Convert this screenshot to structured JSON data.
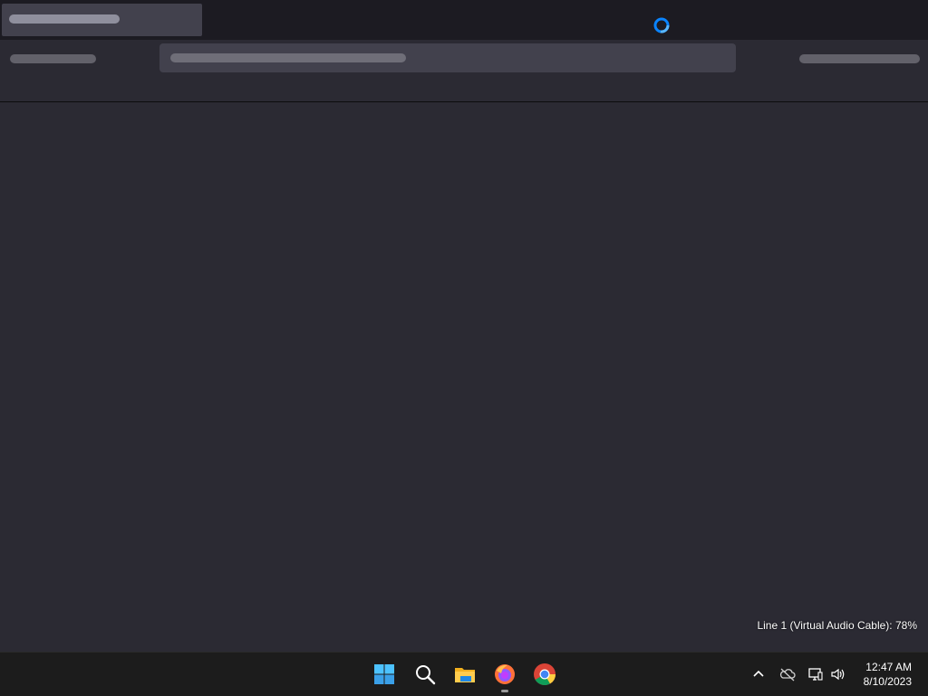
{
  "browser": {
    "tab": {
      "state": "loading"
    },
    "loading_indicator": {
      "color": "#0a84ff"
    },
    "urlbar": {
      "state": "loading"
    }
  },
  "osd": {
    "text": "Line 1 (Virtual Audio Cable): 78%"
  },
  "taskbar": {
    "pinned_apps": [
      {
        "name": "Start",
        "icon": "windows-start-icon"
      },
      {
        "name": "Search",
        "icon": "search-icon"
      },
      {
        "name": "File Explorer",
        "icon": "folder-icon"
      },
      {
        "name": "Firefox",
        "icon": "firefox-icon",
        "running": true
      },
      {
        "name": "Chrome",
        "icon": "chrome-icon"
      }
    ],
    "tray": {
      "icons": [
        "chevron-up-icon",
        "cloud-offline-icon",
        "network-icon",
        "volume-icon"
      ]
    },
    "clock": {
      "time": "12:47 AM",
      "date": "8/10/2023"
    }
  }
}
